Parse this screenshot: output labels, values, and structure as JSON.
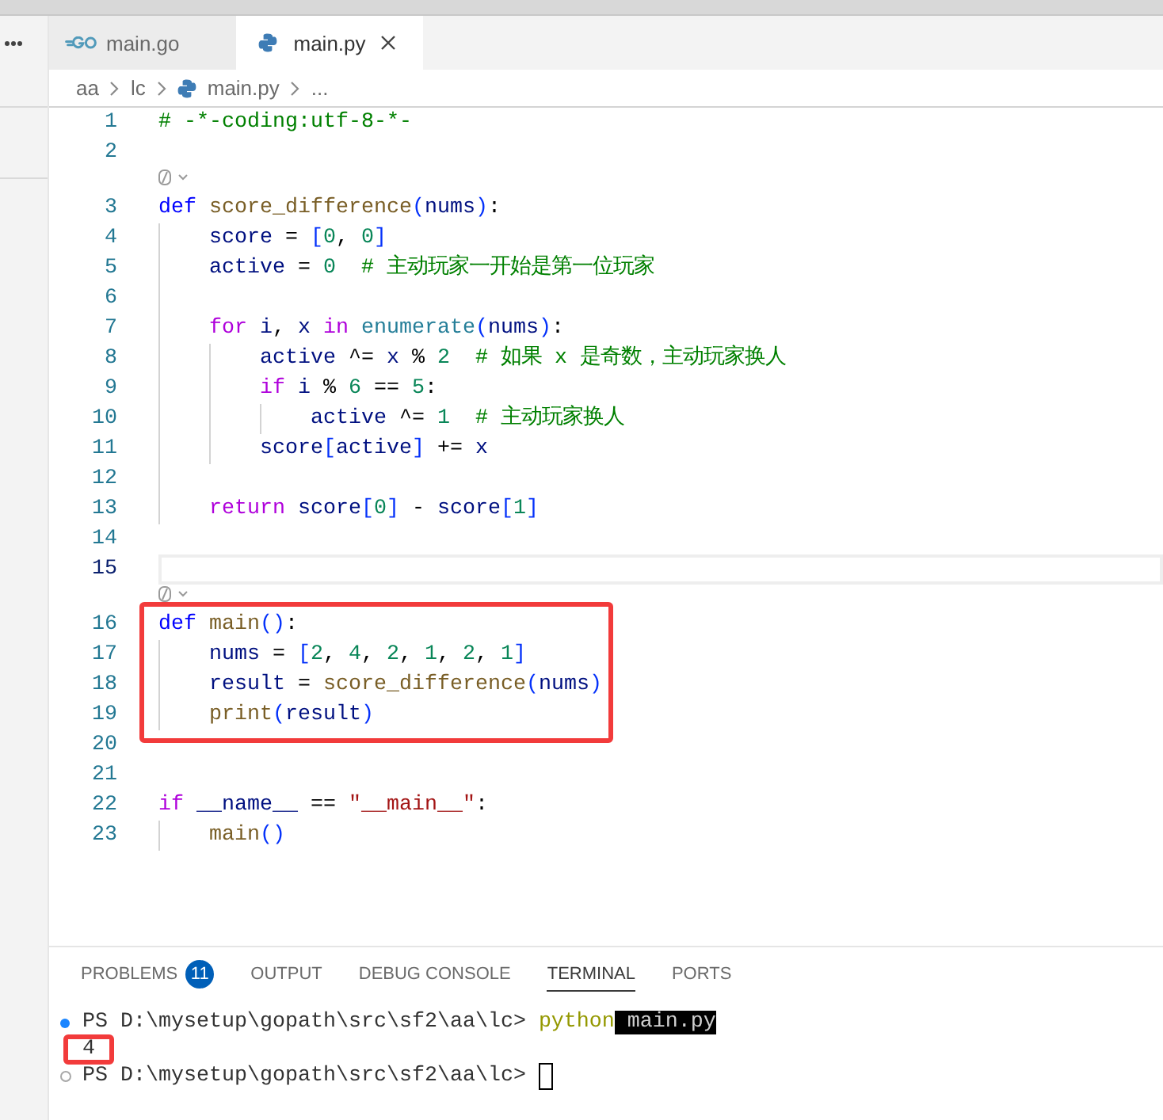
{
  "tabs": [
    {
      "label": "main.go",
      "kind": "go",
      "selected": false
    },
    {
      "label": "main.py",
      "kind": "python",
      "selected": true
    }
  ],
  "breadcrumbs": [
    {
      "label": "aa",
      "kind": "folder"
    },
    {
      "label": "lc",
      "kind": "folder"
    },
    {
      "label": "main.py",
      "kind": "python"
    },
    {
      "label": "...",
      "kind": "symbol"
    }
  ],
  "editor": {
    "lines": [
      {
        "number": "1",
        "current": false,
        "highlighted": false,
        "codelens": false,
        "tokens": [
          {
            "kind": "comment",
            "text": "# -*-coding:utf-8-*-"
          }
        ]
      },
      {
        "number": "2",
        "current": false,
        "highlighted": false,
        "codelens": false
      },
      {
        "number": "3",
        "current": false,
        "highlighted": false,
        "codelens": true,
        "tokens": [
          {
            "kind": "keyword",
            "text": "def "
          },
          {
            "kind": "function",
            "text": "score_difference"
          },
          {
            "kind": "bracket",
            "text": "("
          },
          {
            "kind": "variable",
            "text": "nums"
          },
          {
            "kind": "bracket",
            "text": ")"
          },
          {
            "kind": "operator",
            "text": ":"
          }
        ]
      },
      {
        "number": "4",
        "current": false,
        "highlighted": false,
        "codelens": false,
        "tokens": [
          {
            "kind": "variable",
            "text": "    score"
          },
          {
            "kind": "operator",
            "text": " = "
          },
          {
            "kind": "bracket",
            "text": "["
          },
          {
            "kind": "number",
            "text": "0"
          },
          {
            "kind": "operator",
            "text": ", "
          },
          {
            "kind": "number",
            "text": "0"
          },
          {
            "kind": "bracket",
            "text": "]"
          }
        ]
      },
      {
        "number": "5",
        "current": false,
        "highlighted": false,
        "codelens": false,
        "tokens": [
          {
            "kind": "variable",
            "text": "    active"
          },
          {
            "kind": "operator",
            "text": " = "
          },
          {
            "kind": "number",
            "text": "0"
          },
          {
            "kind": "comment",
            "text": "  # 主动玩家一开始是第一位玩家"
          }
        ]
      },
      {
        "number": "6",
        "current": false,
        "highlighted": false,
        "codelens": false
      },
      {
        "number": "7",
        "current": false,
        "highlighted": false,
        "codelens": false,
        "tokens": [
          {
            "kind": "control",
            "text": "    for "
          },
          {
            "kind": "variable",
            "text": "i"
          },
          {
            "kind": "operator",
            "text": ", "
          },
          {
            "kind": "variable",
            "text": "x "
          },
          {
            "kind": "control",
            "text": "in "
          },
          {
            "kind": "builtin",
            "text": "enumerate"
          },
          {
            "kind": "bracket",
            "text": "("
          },
          {
            "kind": "variable",
            "text": "nums"
          },
          {
            "kind": "bracket",
            "text": ")"
          },
          {
            "kind": "operator",
            "text": ":"
          }
        ]
      },
      {
        "number": "8",
        "current": false,
        "highlighted": false,
        "codelens": false,
        "tokens": [
          {
            "kind": "variable",
            "text": "        active"
          },
          {
            "kind": "operator",
            "text": " ^= "
          },
          {
            "kind": "variable",
            "text": "x"
          },
          {
            "kind": "operator",
            "text": " % "
          },
          {
            "kind": "number",
            "text": "2"
          },
          {
            "kind": "comment",
            "text": "  # 如果 x 是奇数，主动玩家换人"
          }
        ]
      },
      {
        "number": "9",
        "current": false,
        "highlighted": false,
        "codelens": false,
        "tokens": [
          {
            "kind": "control",
            "text": "        if "
          },
          {
            "kind": "variable",
            "text": "i"
          },
          {
            "kind": "operator",
            "text": " % "
          },
          {
            "kind": "number",
            "text": "6"
          },
          {
            "kind": "operator",
            "text": " == "
          },
          {
            "kind": "number",
            "text": "5"
          },
          {
            "kind": "operator",
            "text": ":"
          }
        ]
      },
      {
        "number": "10",
        "current": false,
        "highlighted": false,
        "codelens": false,
        "tokens": [
          {
            "kind": "variable",
            "text": "            active"
          },
          {
            "kind": "operator",
            "text": " ^= "
          },
          {
            "kind": "number",
            "text": "1"
          },
          {
            "kind": "comment",
            "text": "  # 主动玩家换人"
          }
        ]
      },
      {
        "number": "11",
        "current": false,
        "highlighted": false,
        "codelens": false,
        "tokens": [
          {
            "kind": "variable",
            "text": "        score"
          },
          {
            "kind": "bracket",
            "text": "["
          },
          {
            "kind": "variable",
            "text": "active"
          },
          {
            "kind": "bracket",
            "text": "]"
          },
          {
            "kind": "operator",
            "text": " += "
          },
          {
            "kind": "variable",
            "text": "x"
          }
        ]
      },
      {
        "number": "12",
        "current": false,
        "highlighted": false,
        "codelens": false
      },
      {
        "number": "13",
        "current": false,
        "highlighted": false,
        "codelens": false,
        "tokens": [
          {
            "kind": "control",
            "text": "    return "
          },
          {
            "kind": "variable",
            "text": "score"
          },
          {
            "kind": "bracket",
            "text": "["
          },
          {
            "kind": "number",
            "text": "0"
          },
          {
            "kind": "bracket",
            "text": "]"
          },
          {
            "kind": "operator",
            "text": " - "
          },
          {
            "kind": "variable",
            "text": "score"
          },
          {
            "kind": "bracket",
            "text": "["
          },
          {
            "kind": "number",
            "text": "1"
          },
          {
            "kind": "bracket",
            "text": "]"
          }
        ]
      },
      {
        "number": "14",
        "current": false,
        "highlighted": false,
        "codelens": false
      },
      {
        "number": "15",
        "current": true,
        "highlighted": false,
        "codelens": false
      },
      {
        "number": "16",
        "current": false,
        "highlighted": true,
        "codelens": true,
        "tokens": [
          {
            "kind": "keyword",
            "text": "def "
          },
          {
            "kind": "function",
            "text": "main"
          },
          {
            "kind": "bracket",
            "text": "()"
          },
          {
            "kind": "operator",
            "text": ":"
          }
        ]
      },
      {
        "number": "17",
        "current": false,
        "highlighted": true,
        "codelens": false,
        "tokens": [
          {
            "kind": "variable",
            "text": "    nums"
          },
          {
            "kind": "operator",
            "text": " = "
          },
          {
            "kind": "bracket",
            "text": "["
          },
          {
            "kind": "number",
            "text": "2"
          },
          {
            "kind": "operator",
            "text": ", "
          },
          {
            "kind": "number",
            "text": "4"
          },
          {
            "kind": "operator",
            "text": ", "
          },
          {
            "kind": "number",
            "text": "2"
          },
          {
            "kind": "operator",
            "text": ", "
          },
          {
            "kind": "number",
            "text": "1"
          },
          {
            "kind": "operator",
            "text": ", "
          },
          {
            "kind": "number",
            "text": "2"
          },
          {
            "kind": "operator",
            "text": ", "
          },
          {
            "kind": "number",
            "text": "1"
          },
          {
            "kind": "bracket",
            "text": "]"
          }
        ]
      },
      {
        "number": "18",
        "current": false,
        "highlighted": true,
        "codelens": false,
        "tokens": [
          {
            "kind": "variable",
            "text": "    result"
          },
          {
            "kind": "operator",
            "text": " = "
          },
          {
            "kind": "function",
            "text": "score_difference"
          },
          {
            "kind": "bracket",
            "text": "("
          },
          {
            "kind": "variable",
            "text": "nums"
          },
          {
            "kind": "bracket",
            "text": ")"
          }
        ]
      },
      {
        "number": "19",
        "current": false,
        "highlighted": true,
        "codelens": false,
        "tokens": [
          {
            "kind": "function",
            "text": "    print"
          },
          {
            "kind": "bracket",
            "text": "("
          },
          {
            "kind": "variable",
            "text": "result"
          },
          {
            "kind": "bracket",
            "text": ")"
          }
        ]
      },
      {
        "number": "20",
        "current": false,
        "highlighted": false,
        "codelens": false
      },
      {
        "number": "21",
        "current": false,
        "highlighted": false,
        "codelens": false
      },
      {
        "number": "22",
        "current": false,
        "highlighted": false,
        "codelens": false,
        "tokens": [
          {
            "kind": "control",
            "text": "if "
          },
          {
            "kind": "variable",
            "text": "__name__"
          },
          {
            "kind": "operator",
            "text": " == "
          },
          {
            "kind": "string",
            "text": "\"__main__\""
          },
          {
            "kind": "operator",
            "text": ":"
          }
        ]
      },
      {
        "number": "23",
        "current": false,
        "highlighted": false,
        "codelens": false,
        "tokens": [
          {
            "kind": "function",
            "text": "    main"
          },
          {
            "kind": "bracket",
            "text": "()"
          }
        ]
      }
    ]
  },
  "panel": {
    "tabs": [
      {
        "label": "PROBLEMS",
        "badge": "11",
        "selected": false
      },
      {
        "label": "OUTPUT",
        "selected": false
      },
      {
        "label": "DEBUG CONSOLE",
        "selected": false
      },
      {
        "label": "TERMINAL",
        "selected": true
      },
      {
        "label": "PORTS",
        "selected": false
      }
    ],
    "terminal": {
      "lines": [
        {
          "kind": "finished",
          "highlighted": false,
          "cursor": false,
          "segments": [
            {
              "kind": "prompt",
              "text": "PS D:\\mysetup\\gopath\\src\\sf2\\aa\\lc> "
            },
            {
              "kind": "command",
              "text": "python"
            },
            {
              "kind": "selection",
              "text": " main.py"
            }
          ]
        },
        {
          "kind": "output",
          "highlighted": true,
          "cursor": false,
          "segments": [
            {
              "kind": "output",
              "text": "4"
            }
          ]
        },
        {
          "kind": "pending",
          "highlighted": false,
          "cursor": true,
          "segments": [
            {
              "kind": "prompt",
              "text": "PS D:\\mysetup\\gopath\\src\\sf2\\aa\\lc> "
            }
          ]
        }
      ]
    }
  }
}
